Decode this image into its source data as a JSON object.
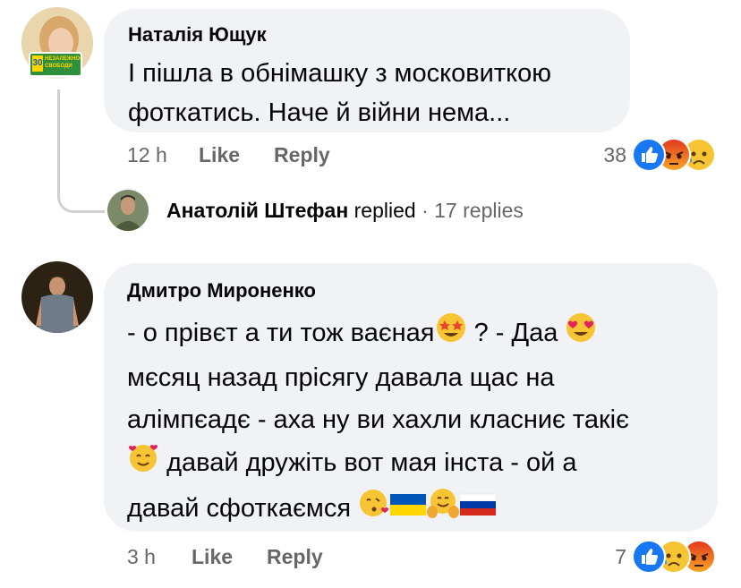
{
  "comment1": {
    "author": "Наталія Ющук",
    "text_line1": "І пішла в обнімашку з московиткою",
    "text_line2": "фоткатись. Наче й війни нема...",
    "time": "12 h",
    "like_label": "Like",
    "reply_label": "Reply",
    "reaction_count": "38",
    "reactions": [
      "like-icon",
      "angry-icon",
      "sad-icon"
    ],
    "badge_text": "НЕЗАЛЕЖНОСТІ СВОБОДИ"
  },
  "reply_summary": {
    "author": "Анатолій Штефан",
    "action": "replied",
    "separator": "·",
    "count": "17 replies"
  },
  "comment2": {
    "author": "Дмитро Мироненко",
    "line1_a": "- о прівєт а ти тож ваєная",
    "line1_b": "? - Даа",
    "line2": "мєсяц назад прісягу давала щас на",
    "line3": "алімпєадє - аха ну ви хахли класниє такіє",
    "line4": "давай дружіть вот мая інста - ой а",
    "line5": "давай сфоткаємся",
    "time": "3 h",
    "like_label": "Like",
    "reply_label": "Reply",
    "reaction_count": "7",
    "reactions": [
      "like-icon",
      "sad-icon",
      "angry-icon"
    ],
    "inline_emojis": [
      "star-struck-icon",
      "heart-eyes-icon",
      "smiling-hearts-icon",
      "kissing-heart-icon",
      "ukraine-flag-icon",
      "hugging-icon",
      "russia-flag-icon"
    ]
  },
  "colors": {
    "bubble": "#f0f2f5",
    "meta": "#65676b",
    "like_blue": "#1877f2",
    "angry": "#f15a24",
    "sad": "#f7b125"
  }
}
